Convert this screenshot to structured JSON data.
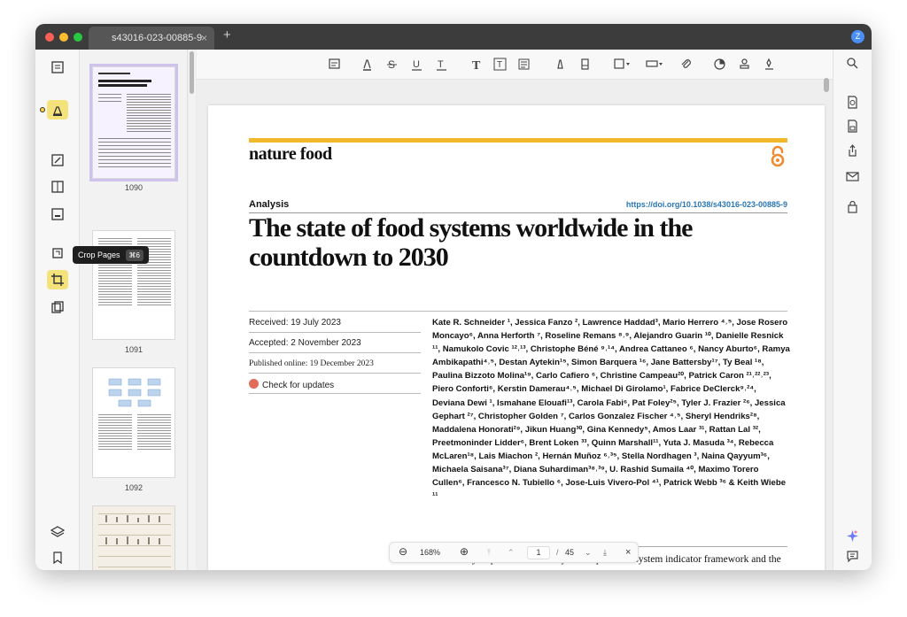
{
  "tab": {
    "title": "s43016-023-00885-9",
    "close": "×",
    "new": "+"
  },
  "user": {
    "initial": "Z"
  },
  "tooltip": {
    "label": "Crop Pages",
    "shortcut": "⌘6"
  },
  "thumbnails": [
    {
      "label": "1090",
      "selected": true
    },
    {
      "label": "1091",
      "selected": false
    },
    {
      "label": "1092",
      "selected": false
    },
    {
      "label": "",
      "selected": false
    }
  ],
  "document": {
    "journal": "nature food",
    "article_type": "Analysis",
    "doi": "https://doi.org/10.1038/s43016-023-00885-9",
    "title": "The state of food systems worldwide in the countdown to 2030",
    "received": "Received: 19 July 2023",
    "accepted": "Accepted: 2 November 2023",
    "published": "Published online: 19 December 2023",
    "check_updates": "Check for updates",
    "authors": "Kate R. Schneider ¹, Jessica Fanzo ², Lawrence Haddad³, Mario Herrero ⁴˒⁵, Jose Rosero Moncayo⁶, Anna Herforth ⁷, Roseline Remans ⁸˒⁹, Alejandro Guarin ¹⁰, Danielle Resnick ¹¹, Namukolo Covic ¹²˒¹³, Christophe Béné ⁹˒¹⁴, Andrea Cattaneo ⁶, Nancy Aburto⁶, Ramya Ambikapathi⁴˒⁵, Destan Aytekin¹⁵, Simon Barquera ¹⁶, Jane Battersby¹⁷, Ty Beal ¹⁸, Paulina Bizzoto Molina¹⁹, Carlo Cafiero ⁶, Christine Campeau²⁰, Patrick Caron ²¹˒²²˒²³, Piero Conforti⁶, Kerstin Damerau⁴˒⁵, Michael Di Girolamo¹, Fabrice DeClerck⁹˒²⁴, Deviana Dewi ¹, Ismahane Elouafi¹³, Carola Fabi⁶, Pat Foley²⁵, Tyler J. Frazier ²⁶, Jessica Gephart ²⁷, Christopher Golden ⁷, Carlos Gonzalez Fischer ⁴˒⁵, Sheryl Hendriks²⁸, Maddalena Honorati²⁹, Jikun Huang³⁰, Gina Kennedy⁵, Amos Laar ³¹, Rattan Lal ³², Preetmoninder Lidder⁶, Brent Loken ³³, Quinn Marshall¹¹, Yuta J. Masuda ³⁴, Rebecca McLaren¹⁸, Lais Miachon ², Hernán Muñoz ⁶˒³⁵, Stella Nordhagen ³, Naina Qayyum³⁶, Michaela Saisana³⁷, Diana Suhardiman³⁸˒³⁹, U. Rashid Sumaila ⁴⁰, Maximo Torero Cullen⁶, Francesco N. Tubiello ⁶, Jose-Luis Vivero-Pol ⁴¹, Patrick Webb ³⁶ & Keith Wiebe ¹¹",
    "abstract": "This Analysis presents a recently developed food system indicator framework and the tracking of food system transformation towards global development, health and sustainability goals. Five themes are"
  },
  "zoom": {
    "minus": "⊖",
    "level": "168%",
    "plus": "⊕",
    "page": "1",
    "sep": "/",
    "total": "45",
    "close": "×"
  },
  "colors": {
    "accent_yellow": "#f2b82c",
    "doi_blue": "#2a77b6",
    "oa_orange": "#f08a2e"
  }
}
